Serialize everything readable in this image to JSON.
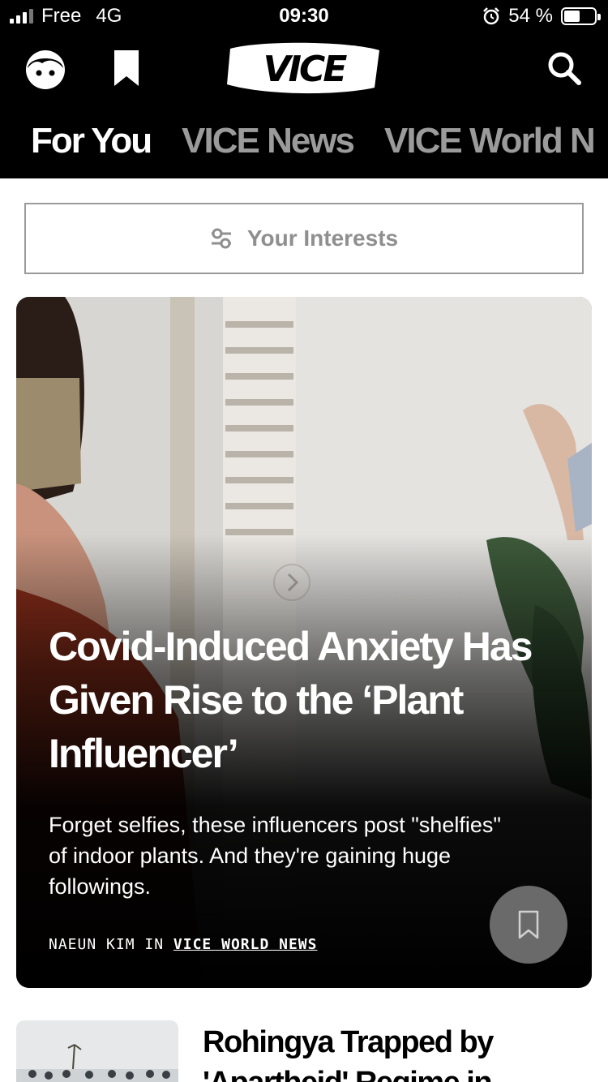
{
  "status_bar": {
    "carrier": "Free",
    "network": "4G",
    "time": "09:30",
    "battery_percent": "54 %",
    "battery_level": 0.54
  },
  "header": {
    "logo_text": "VICE",
    "icons": [
      "profile-face-icon",
      "bookmark-icon",
      "search-icon"
    ]
  },
  "tabs": [
    {
      "label": "For You",
      "active": true
    },
    {
      "label": "VICE News",
      "active": false
    },
    {
      "label": "VICE World N",
      "active": false
    }
  ],
  "interests": {
    "label": "Your Interests",
    "icon": "sliders-icon"
  },
  "hero": {
    "title": "Covid-Induced Anxiety Has Given Rise to the ‘Plant Influencer’",
    "dek": "Forget selfies, these influencers post \"shelfies\" of indoor plants. And they're gaining huge followings.",
    "author": "NAEUN KIM",
    "byline_in": "IN",
    "section": "VICE WORLD NEWS",
    "save_icon": "bookmark-outline-icon"
  },
  "article2": {
    "title": "Rohingya Trapped by 'Apartheid' Regime in"
  },
  "colors": {
    "header_bg": "#000000",
    "tab_inactive": "#9b9b9b",
    "interests_border": "#9a9a9a"
  }
}
